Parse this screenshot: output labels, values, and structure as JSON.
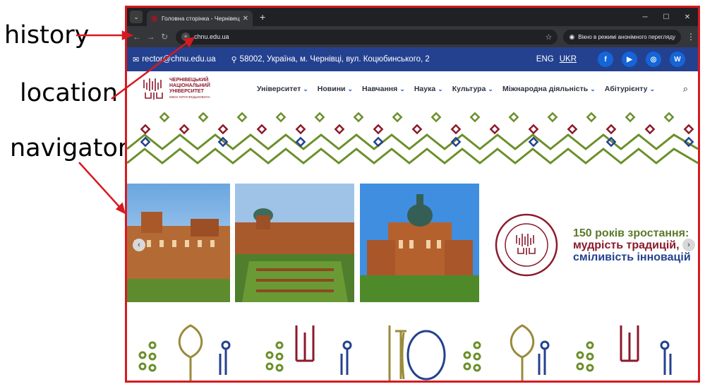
{
  "annotations": {
    "history": "history",
    "location": "location",
    "navigator": "navigator"
  },
  "browser": {
    "tab_title": "Головна сторінка - Чернівецьк",
    "url": "chnu.edu.ua",
    "incognito_label": "Вікно в режимі анонімного перегляду"
  },
  "topbar": {
    "email": "rector@chnu.edu.ua",
    "address": "58002, Україна, м. Чернівці, вул. Коцюбинського, 2",
    "lang_eng": "ENG",
    "lang_ukr": "UKR",
    "socials": [
      "f",
      "▶",
      "◎",
      "W"
    ]
  },
  "logo": {
    "line1": "ЧЕРНІВЕЦЬКИЙ",
    "line2": "НАЦІОНАЛЬНИЙ",
    "line3": "УНІВЕРСИТЕТ",
    "line4": "ІМЕНІ ЮРІЯ ФЕДЬКОВИЧА"
  },
  "menu": {
    "items": [
      "Університет",
      "Новини",
      "Навчання",
      "Наука",
      "Культура",
      "Міжнародна діяльність",
      "Абітурієнту"
    ]
  },
  "hero": {
    "slogan_line1": "150 років зростання:",
    "slogan_line2": "мудрість традицій,",
    "slogan_line3": "сміливість інновацій"
  },
  "colors": {
    "accent_red": "#d71920",
    "brand_blue": "#24418f",
    "brand_burgundy": "#8b1a2b",
    "brand_green": "#5a7a2a"
  }
}
